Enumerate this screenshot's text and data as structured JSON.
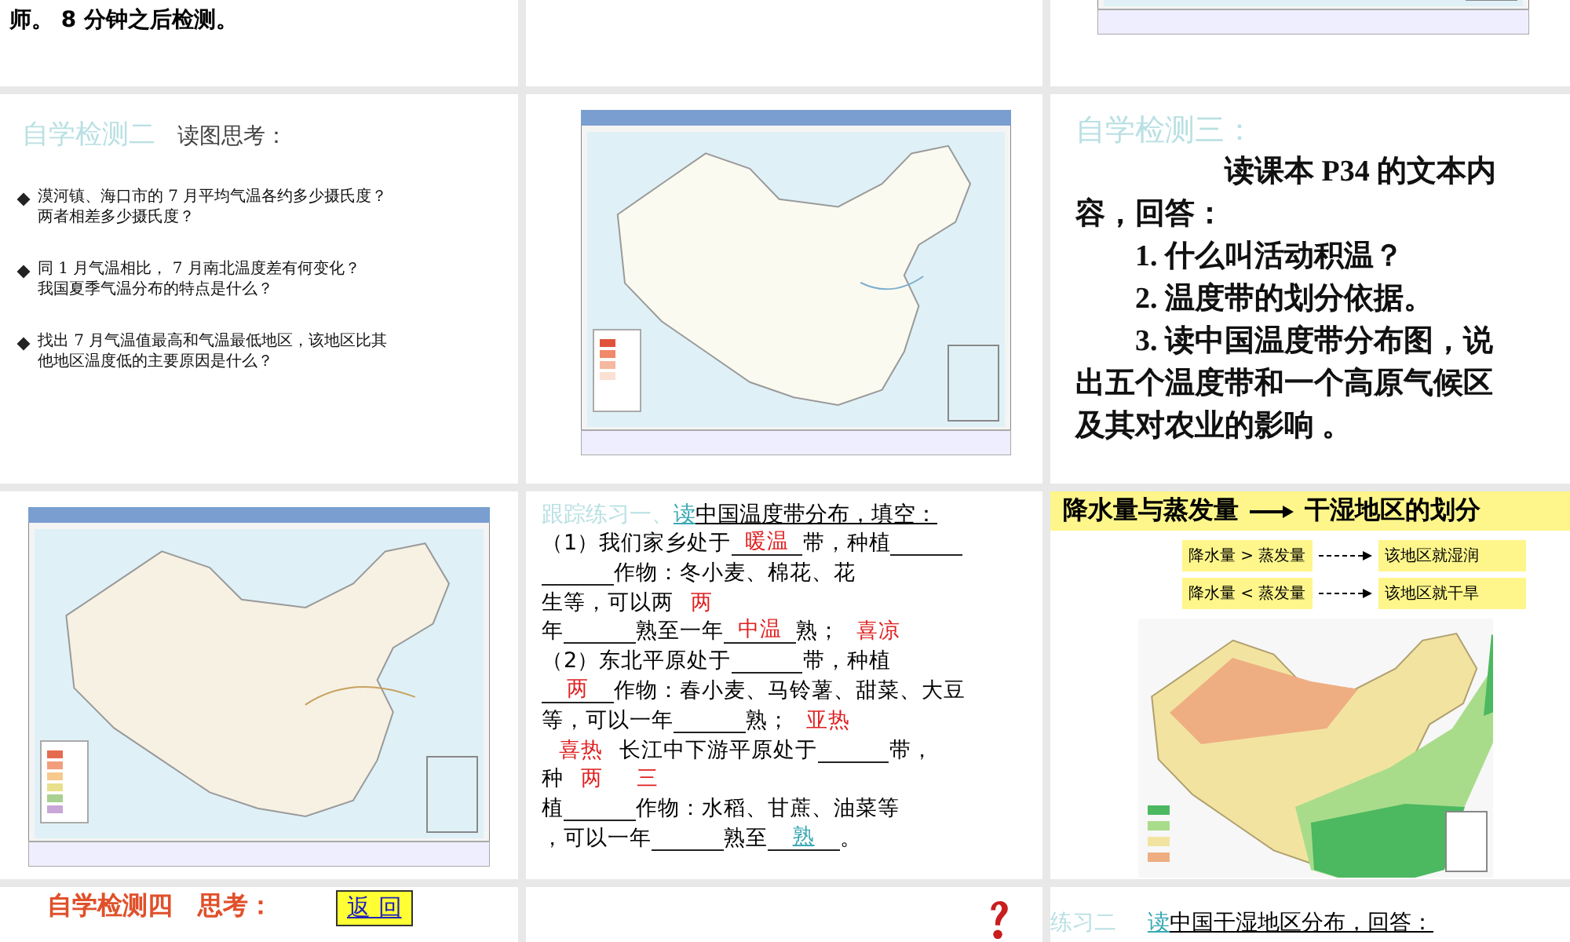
{
  "slides": [
    {
      "kind": "note",
      "text": "师。 8 分钟之后检测。"
    },
    {
      "kind": "empty"
    },
    {
      "kind": "map"
    },
    {
      "kind": "questions",
      "title": "自学检测二",
      "subtitle": "读图思考：",
      "bullets": [
        {
          "lines": [
            "漠河镇、海口市的 7 月平均气温各约多少摄氏度？",
            "两者相差多少摄氏度？"
          ]
        },
        {
          "lines": [
            "同 1 月气温相比， 7 月南北温度差有何变化？",
            "我国夏季气温分布的特点是什么？"
          ]
        },
        {
          "lines": [
            "找出 7 月气温值最高和气温最低地区，该地区比其",
            "他地区温度低的主要原因是什么？"
          ]
        }
      ]
    },
    {
      "kind": "map"
    },
    {
      "kind": "reading",
      "title": "自学检测三：",
      "paragraphs": [
        "读课本 P34 的文本内容，回答：",
        "1. 什么叫活动积温？",
        "2. 温度带的划分依据。",
        "3. 读中国温度带分布图，说出五个温度带和一个高原气候区及其对农业的影响 。"
      ]
    },
    {
      "kind": "map"
    },
    {
      "kind": "fill",
      "prefix": "跟踪练习一、",
      "link": "读",
      "rest": "中国温度带分布，填空：",
      "lines": [
        [
          {
            "kind": "text",
            "text": "（1）我们家乡处于"
          },
          {
            "kind": "blank",
            "answer": "暖温"
          },
          {
            "kind": "text",
            "text": "带，种植"
          },
          {
            "kind": "blank"
          }
        ],
        [
          {
            "kind": "blank"
          },
          {
            "kind": "text",
            "text": "作物：冬小麦、棉花、花"
          }
        ],
        [
          {
            "kind": "text",
            "text": "生等，可以两"
          },
          {
            "kind": "answer",
            "text": "两"
          }
        ],
        [
          {
            "kind": "text",
            "text": "年"
          },
          {
            "kind": "blank"
          },
          {
            "kind": "text",
            "text": "熟至一年"
          },
          {
            "kind": "blank",
            "answer": "中温"
          },
          {
            "kind": "text",
            "text": "熟；"
          },
          {
            "kind": "answer",
            "text": "喜凉"
          }
        ],
        [
          {
            "kind": "text",
            "text": "（2）东北平原处于"
          },
          {
            "kind": "blank"
          },
          {
            "kind": "text",
            "text": "带，种植"
          }
        ],
        [
          {
            "kind": "blank",
            "answer": "两"
          },
          {
            "kind": "text",
            "text": "作物：春小麦、马铃薯、甜菜、大豆"
          }
        ],
        [
          {
            "kind": "text",
            "text": "等，可以一年"
          },
          {
            "kind": "blank"
          },
          {
            "kind": "text",
            "text": "熟；"
          },
          {
            "kind": "answer",
            "text": "亚热"
          }
        ],
        [
          {
            "kind": "answer",
            "text": "喜热"
          },
          {
            "kind": "text",
            "text": "长江中下游平原处于"
          },
          {
            "kind": "blank"
          },
          {
            "kind": "text",
            "text": "带，"
          }
        ],
        [
          {
            "kind": "text",
            "text": "种"
          },
          {
            "kind": "answer",
            "text": "两"
          },
          {
            "kind": "answer",
            "text": "三"
          }
        ],
        [
          {
            "kind": "text",
            "text": "植"
          },
          {
            "kind": "blank"
          },
          {
            "kind": "text",
            "text": "作物：水稻、甘蔗、油菜等"
          }
        ],
        [
          {
            "kind": "text",
            "text": "，可以一年"
          },
          {
            "kind": "blank"
          },
          {
            "kind": "text",
            "text": "熟至"
          },
          {
            "kind": "blank",
            "link": "熟"
          },
          {
            "kind": "text",
            "text": "。"
          }
        ]
      ]
    },
    {
      "kind": "humidity",
      "heading_left": "降水量与蒸发量",
      "heading_right": "干湿地区的划分",
      "rules": [
        {
          "left": "降水量 > 蒸发量",
          "right": "该地区就湿润"
        },
        {
          "left": "降水量 < 蒸发量",
          "right": "该地区就干旱"
        }
      ]
    },
    {
      "kind": "task",
      "title": "自学检测四　思考：",
      "button": "返 回"
    },
    {
      "kind": "question"
    },
    {
      "kind": "exercise",
      "prefix": "练习二",
      "link": "读",
      "rest": "中国干湿地区分布，回答："
    }
  ]
}
